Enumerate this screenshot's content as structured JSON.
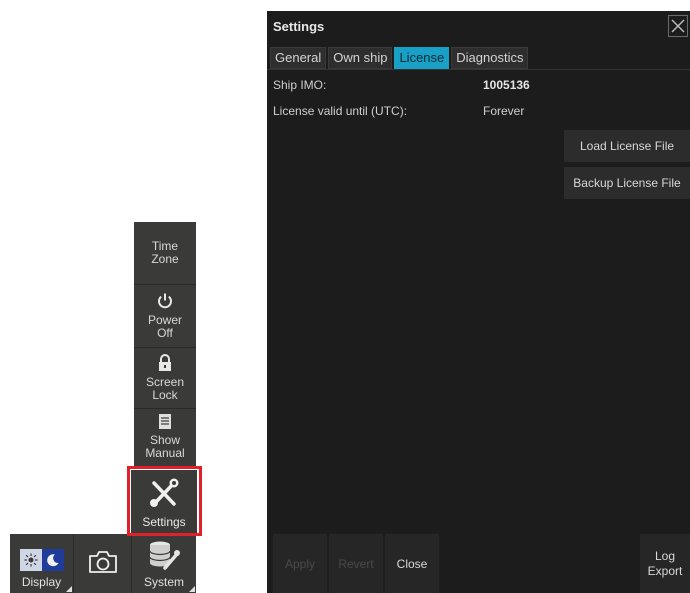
{
  "side_menu": {
    "time_zone": {
      "line1": "Time",
      "line2": "Zone"
    },
    "power_off": {
      "line1": "Power",
      "line2": "Off"
    },
    "screen_lock": {
      "line1": "Screen",
      "line2": "Lock"
    },
    "show_manual": {
      "line1": "Show",
      "line2": "Manual"
    },
    "settings": {
      "label": "Settings"
    }
  },
  "taskbar": {
    "display": "Display",
    "system": "System"
  },
  "dialog": {
    "title": "Settings",
    "tabs": [
      "General",
      "Own ship",
      "License",
      "Diagnostics"
    ],
    "active_tab": "License",
    "fields": {
      "ship_imo_label": "Ship IMO:",
      "ship_imo_value": "1005136",
      "license_valid_label": "License valid until (UTC):",
      "license_valid_value": "Forever"
    },
    "buttons": {
      "load_license": "Load License File",
      "backup_license": "Backup License File"
    },
    "footer": {
      "apply": "Apply",
      "revert": "Revert",
      "close": "Close",
      "log_export_line1": "Log",
      "log_export_line2": "Export"
    }
  },
  "colors": {
    "highlight": "#e0202a",
    "active_tab": "#19a0c6",
    "dialog_bg": "#1c1c1c",
    "menu_bg": "#3a3a38"
  },
  "icons": {
    "power": "power-icon",
    "lock": "lock-icon",
    "manual": "document-icon",
    "settings": "wrench-screwdriver-icon",
    "camera": "camera-icon",
    "display": "sun-moon-icon",
    "system": "database-wrench-icon",
    "close": "close-icon"
  }
}
